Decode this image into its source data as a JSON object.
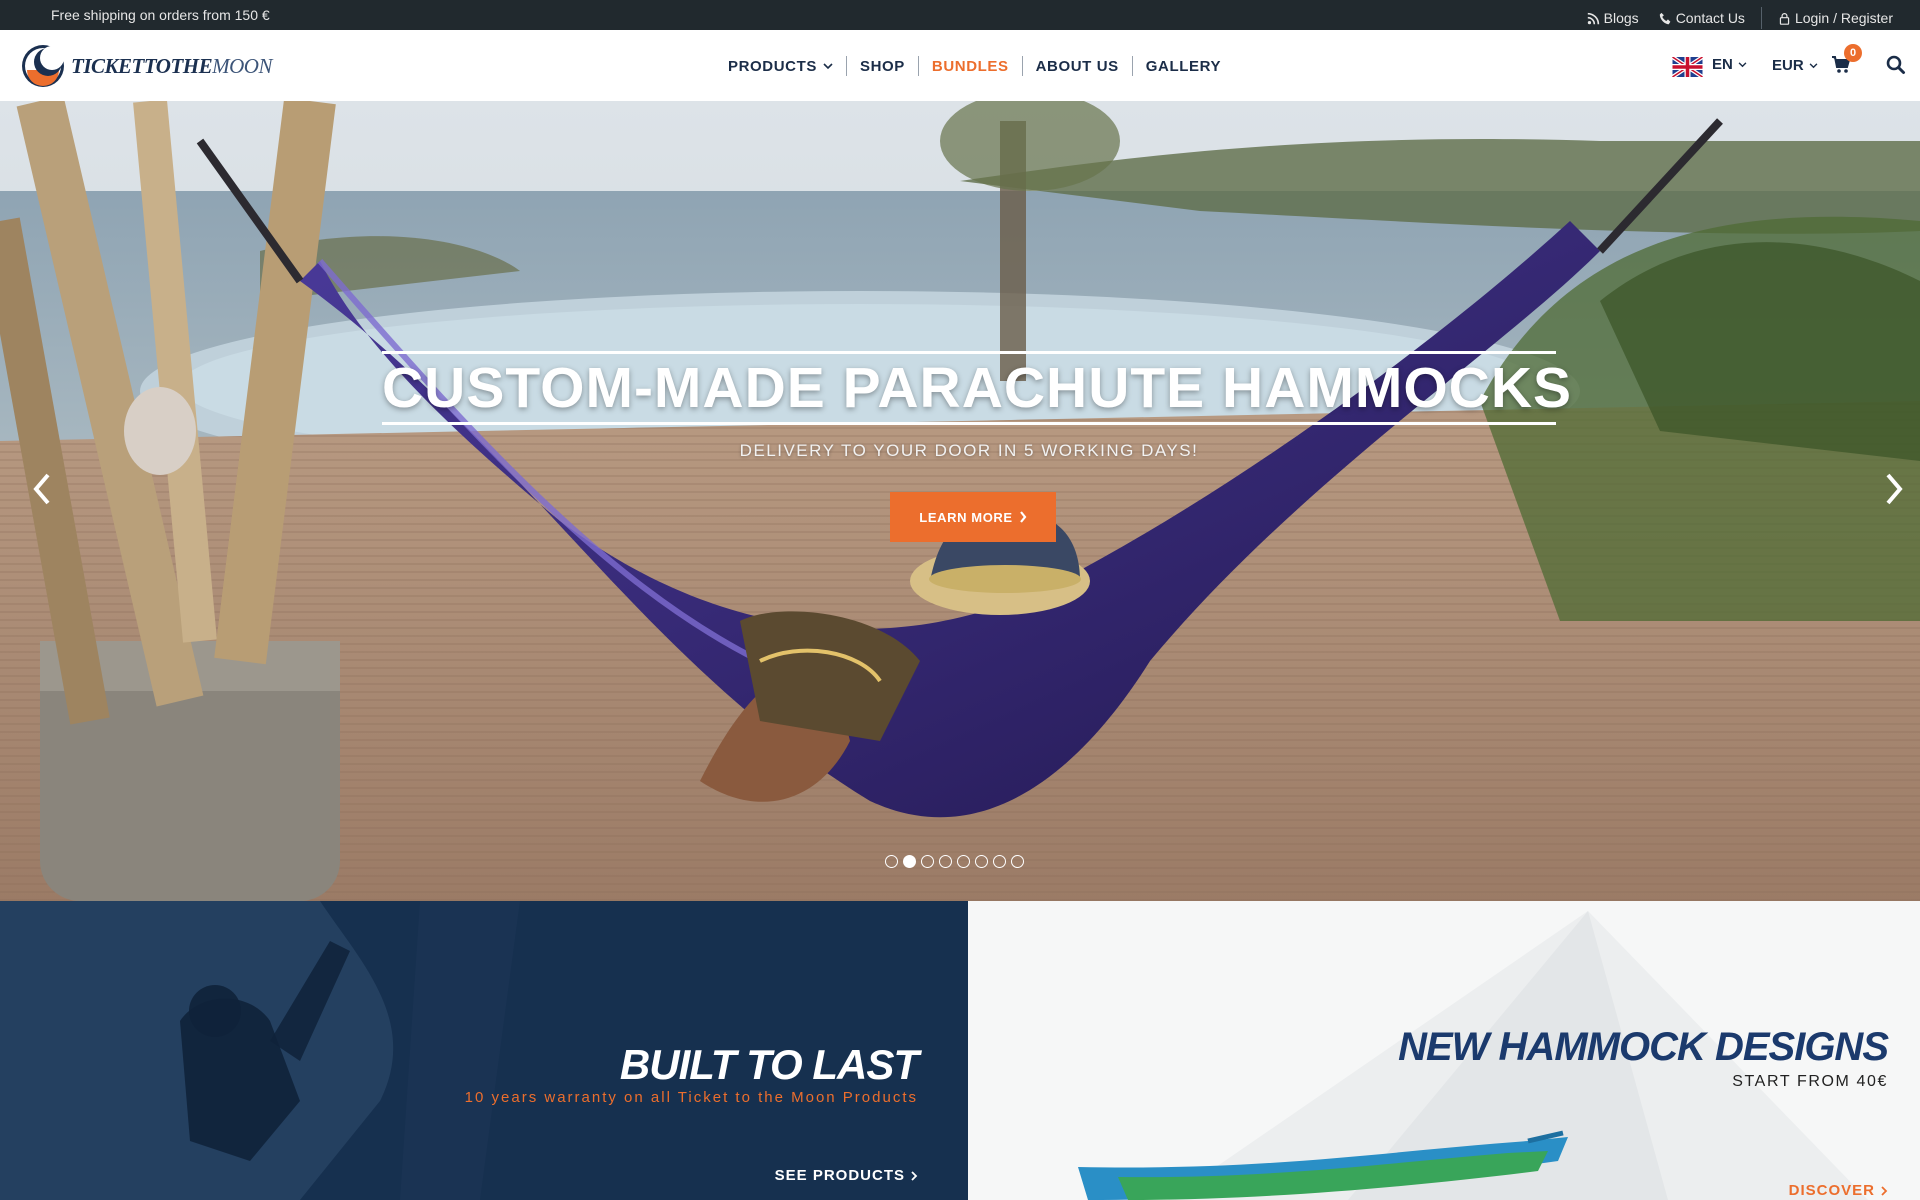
{
  "topbar": {
    "promo": "Free shipping on orders from 150 €",
    "blogs": "Blogs",
    "contact": "Contact Us",
    "login": "Login / Register"
  },
  "header": {
    "logo_part1": "TICKETTOTHE",
    "logo_part2": "MOON",
    "nav": {
      "products": "PRODUCTS",
      "shop": "SHOP",
      "bundles": "BUNDLES",
      "about": "ABOUT US",
      "gallery": "GALLERY"
    },
    "language": "EN",
    "currency": "EUR",
    "cart_count": "0"
  },
  "hero": {
    "title": "CUSTOM-MADE PARACHUTE HAMMOCKS",
    "subtitle": "DELIVERY TO YOUR DOOR IN 5 WORKING DAYS!",
    "cta": "LEARN MORE",
    "slides": 8,
    "active_slide": 2
  },
  "panels": {
    "left": {
      "title": "BUILT TO LAST",
      "subtitle": "10 years warranty on all Ticket to the Moon Products",
      "link": "SEE PRODUCTS"
    },
    "right": {
      "title": "NEW HAMMOCK DESIGNS",
      "subtitle": "START FROM 40€",
      "link": "DISCOVER"
    }
  },
  "colors": {
    "accent": "#ec6e2d",
    "navy": "#1b2d48",
    "topbar": "#21292e",
    "panel_left": "#16304f"
  },
  "icons": [
    "rss-icon",
    "phone-icon",
    "user-icon",
    "chevron-down-icon",
    "uk-flag-icon",
    "cart-icon",
    "search-icon",
    "chevron-left-icon",
    "chevron-right-icon"
  ]
}
